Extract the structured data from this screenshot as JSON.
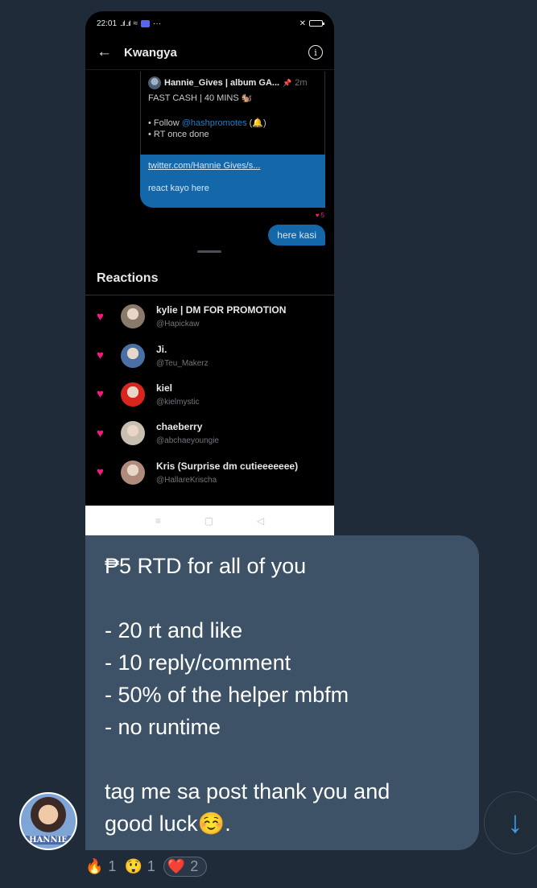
{
  "phone": {
    "status": {
      "time": "22:01",
      "signal": "..ıl ..ıl",
      "more": "···"
    },
    "header": {
      "title": "Kwangya"
    },
    "quoted": {
      "name": "Hannie_Gives | album GA...",
      "time": "2m",
      "line1": "FAST CASH | 40 MINS 🐿️",
      "line2": "• Follow ",
      "line2_link": "@hashpromotes",
      "line2_end": " (🔔)",
      "line3": "• RT once done"
    },
    "blue_bubble": {
      "link": "twitter.com/Hannie Gives/s...",
      "text": "react kayo here"
    },
    "tiny_reaction": {
      "count": "5"
    },
    "reply_bubble": "here kasi",
    "reactions_title": "Reactions",
    "reactions": [
      {
        "name": "kylie | DM FOR PROMOTION",
        "handle": "@Hapickaw",
        "avatar_color": "#8a7a6a"
      },
      {
        "name": "Ji.",
        "handle": "@Teu_Makerz",
        "avatar_color": "#4a6fa5"
      },
      {
        "name": "kiel",
        "handle": "@kielmystic",
        "avatar_color": "#d8261c"
      },
      {
        "name": "chaeberry",
        "handle": "@abchaeyoungie",
        "avatar_color": "#c9bfb0"
      },
      {
        "name": "Kris (Surprise dm cutieeeeeee)",
        "handle": "@HallareKrischa",
        "avatar_color": "#b08a7a"
      }
    ],
    "nav": {
      "menu": "≡",
      "home": "▢",
      "back": "◁"
    }
  },
  "message": {
    "lines": [
      "₱5 RTD for all of you",
      "",
      "- 20 rt and like",
      "- 10 reply/comment",
      "- 50% of the helper mbfm",
      "- no runtime",
      "",
      "tag me sa post thank you and",
      "good luck☺️."
    ]
  },
  "sender": {
    "avatar_tag": "HANNIE"
  },
  "scroll_icon": "↓",
  "message_reactions": [
    {
      "emoji": "🔥",
      "count": "1"
    },
    {
      "emoji": "😲",
      "count": "1"
    },
    {
      "emoji": "❤️",
      "count": "2"
    }
  ]
}
